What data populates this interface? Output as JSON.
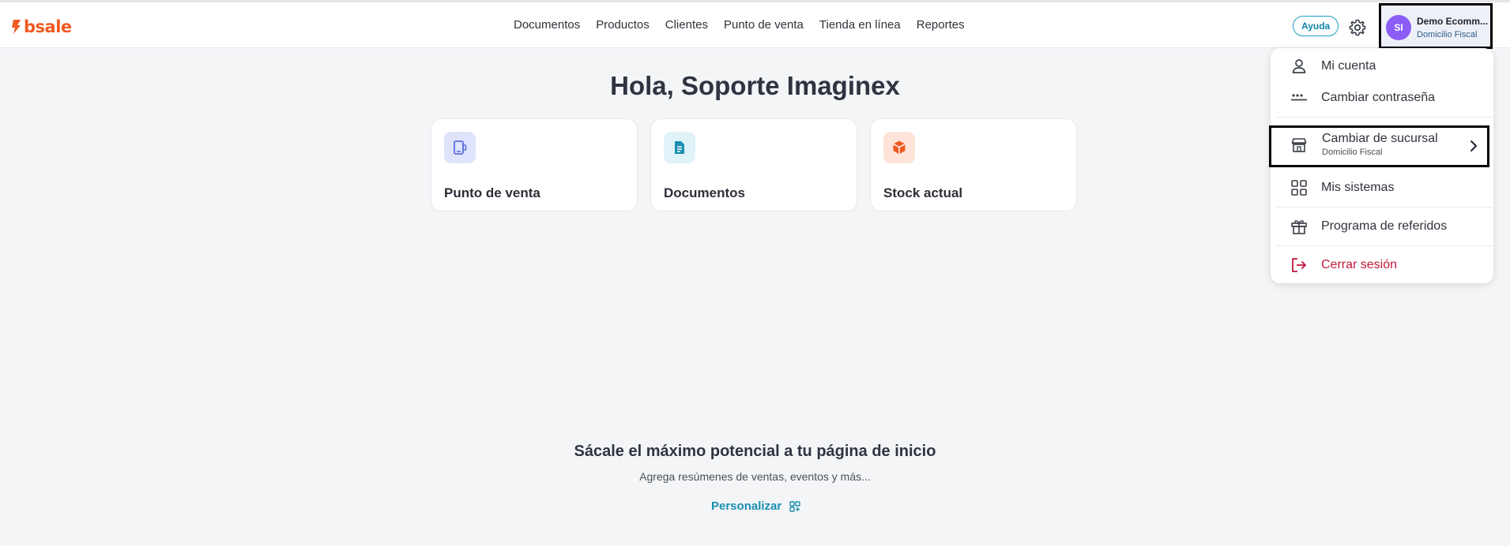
{
  "brand": {
    "logo_text": "bsale",
    "color": "#f15a22"
  },
  "nav": {
    "items": [
      {
        "label": "Documentos"
      },
      {
        "label": "Productos"
      },
      {
        "label": "Clientes"
      },
      {
        "label": "Punto de venta"
      },
      {
        "label": "Tienda en línea"
      },
      {
        "label": "Reportes"
      }
    ]
  },
  "header": {
    "help_label": "Ayuda",
    "settings_icon": "gear-icon",
    "account": {
      "initials": "SI",
      "name": "Demo Ecomm...",
      "branch": "Domicilio Fiscal",
      "avatar_color": "#8b5cf6"
    }
  },
  "main": {
    "greeting": "Hola, Soporte Imaginex",
    "cards": [
      {
        "label": "Punto de venta",
        "icon": "pos-icon",
        "icon_bg": "#dfe3fb",
        "icon_color": "#5b6ee0"
      },
      {
        "label": "Documentos",
        "icon": "document-icon",
        "icon_bg": "#dff3f8",
        "icon_color": "#1a8fb0"
      },
      {
        "label": "Stock actual",
        "icon": "box-icon",
        "icon_bg": "#fde3d8",
        "icon_color": "#f15a22"
      }
    ],
    "promo": {
      "title": "Sácale el máximo potencial a tu página de inicio",
      "subtitle": "Agrega resúmenes de ventas, eventos y más...",
      "action_label": "Personalizar"
    }
  },
  "account_menu": {
    "items": [
      {
        "label": "Mi cuenta",
        "icon": "user-icon"
      },
      {
        "label": "Cambiar contraseña",
        "icon": "password-icon"
      },
      {
        "label": "Cambiar de sucursal",
        "sublabel": "Domicilio Fiscal",
        "icon": "store-icon"
      },
      {
        "label": "Mis sistemas",
        "icon": "grid-icon"
      },
      {
        "label": "Programa de referidos",
        "icon": "gift-icon"
      },
      {
        "label": "Cerrar sesión",
        "icon": "logout-icon",
        "color": "#c0183a"
      }
    ]
  }
}
